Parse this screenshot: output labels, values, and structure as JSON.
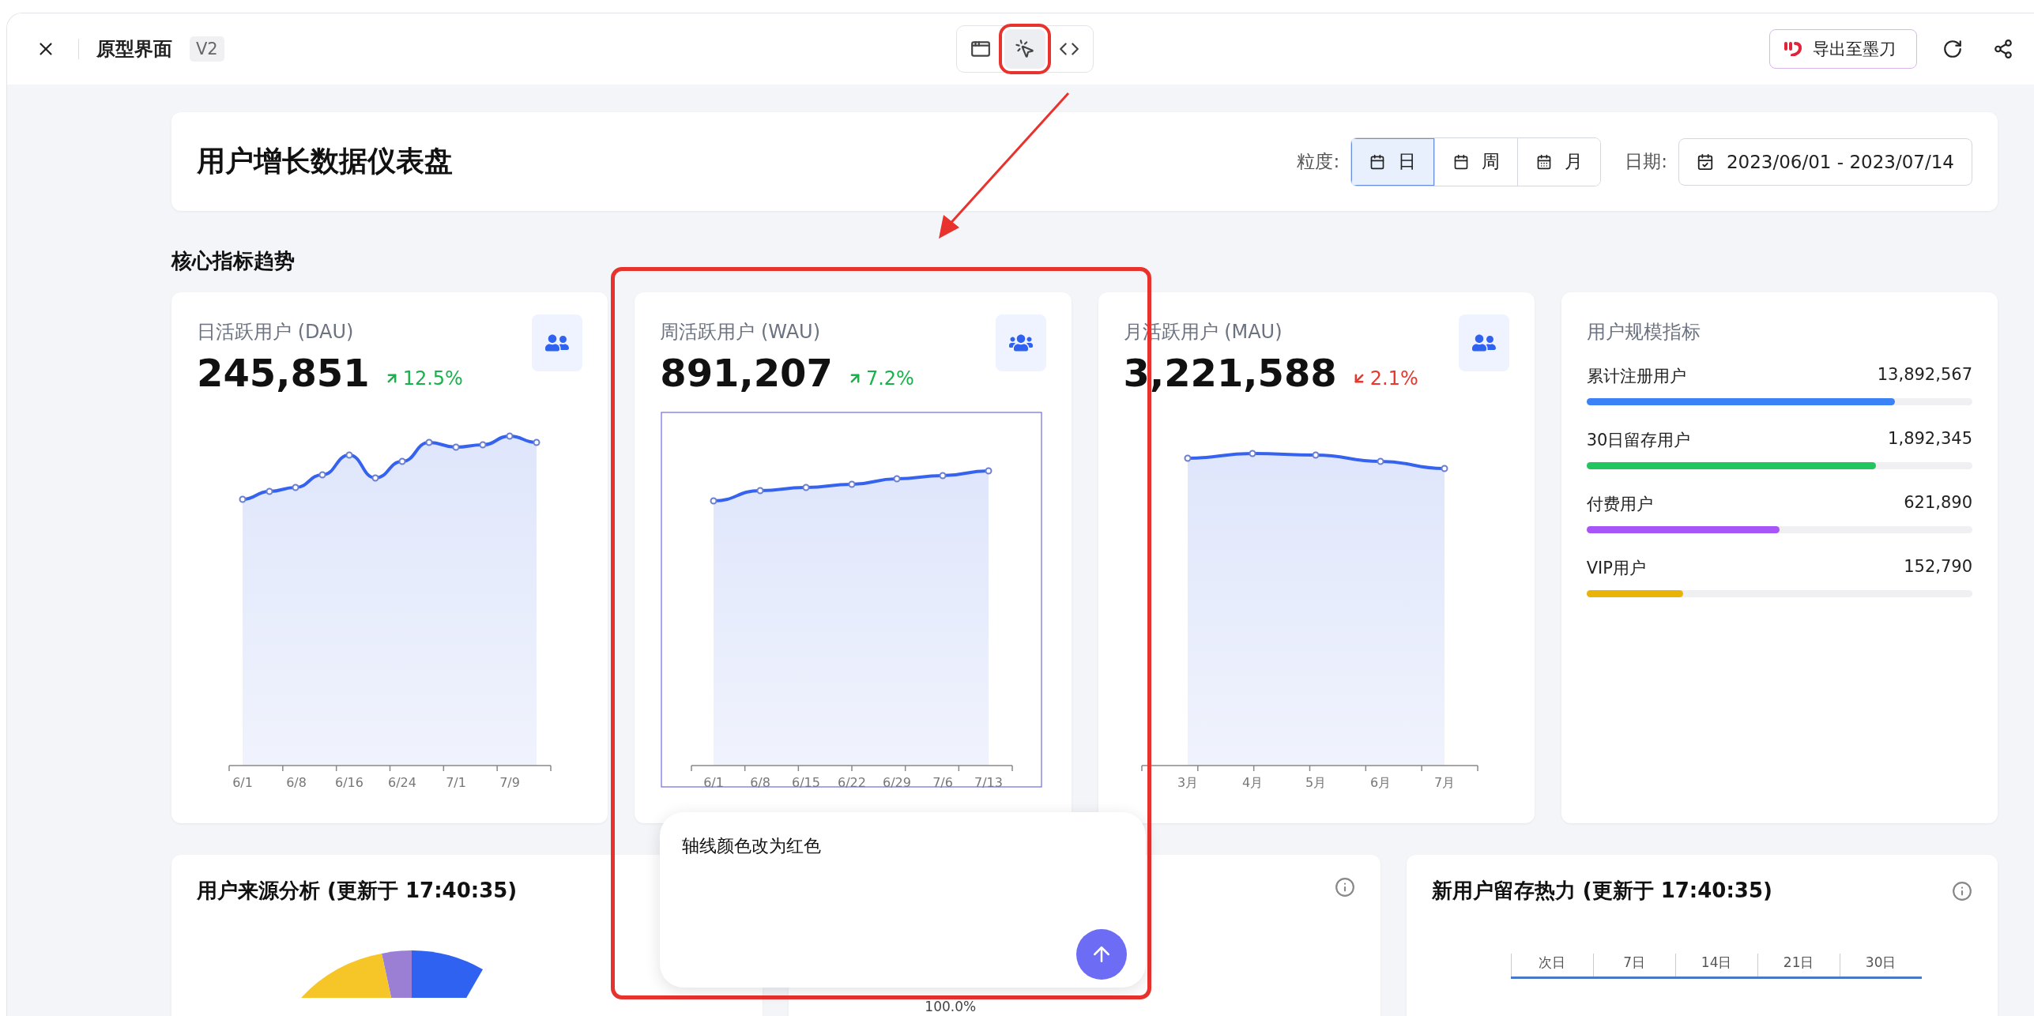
{
  "topbar": {
    "title": "原型界面",
    "version": "V2",
    "view_modes": [
      {
        "kind": "preview",
        "selected": false
      },
      {
        "kind": "select",
        "selected": true
      },
      {
        "kind": "code",
        "selected": false
      }
    ],
    "export_label": "导出至墨刀"
  },
  "header": {
    "title": "用户增长数据仪表盘",
    "granularity_label": "粒度:",
    "granularity": [
      {
        "label": "日",
        "selected": true
      },
      {
        "label": "周",
        "selected": false
      },
      {
        "label": "月",
        "selected": false
      }
    ],
    "date_label": "日期:",
    "date_range": "2023/06/01 - 2023/07/14"
  },
  "section_title": "核心指标趋势",
  "metrics": [
    {
      "title": "日活跃用户 (DAU)",
      "value": "245,851",
      "change": "12.5%",
      "kind": "rise",
      "selected": false,
      "x_labels": [
        "6/1",
        "6/8",
        "6/16",
        "6/24",
        "7/1",
        "7/9"
      ]
    },
    {
      "title": "周活跃用户 (WAU)",
      "value": "891,207",
      "change": "7.2%",
      "kind": "rise",
      "selected": true,
      "x_labels": [
        "6/1",
        "6/8",
        "6/15",
        "6/22",
        "6/29",
        "7/6",
        "7/13"
      ]
    },
    {
      "title": "月活跃用户 (MAU)",
      "value": "3,221,588",
      "change": "2.1%",
      "kind": "fall",
      "selected": false,
      "x_labels": [
        "3月",
        "4月",
        "5月",
        "6月",
        "7月"
      ]
    }
  ],
  "scale": {
    "title": "用户规模指标",
    "rows": [
      {
        "label": "累计注册用户",
        "value": "13,892,567",
        "level": 0.8,
        "color": "#3b82f6"
      },
      {
        "label": "30日留存用户",
        "value": "1,892,345",
        "level": 0.75,
        "color": "#22c55e"
      },
      {
        "label": "付费用户",
        "value": "621,890",
        "level": 0.5,
        "color": "#a855f7"
      },
      {
        "label": "VIP用户",
        "value": "152,790",
        "level": 0.25,
        "color": "#eab308"
      }
    ]
  },
  "source_card": {
    "title": "用户来源分析 (更新于 17:40:35)"
  },
  "middle_card": {
    "label": "100.0%"
  },
  "retention_card": {
    "title": "新用户留存热力 (更新于 17:40:35)",
    "columns": [
      "次日",
      "7日",
      "14日",
      "21日",
      "30日"
    ]
  },
  "prompt": {
    "value": "轴线颜色改为红色"
  }
}
